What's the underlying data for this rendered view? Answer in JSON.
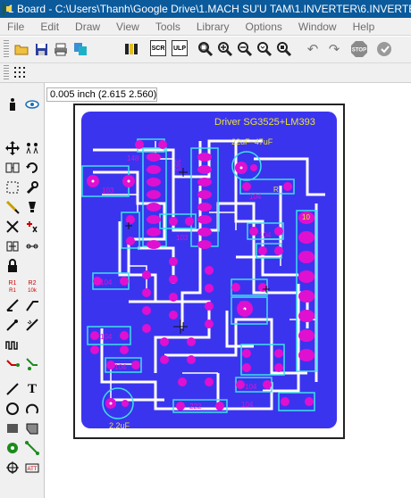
{
  "window": {
    "title": "1 Board - C:\\Users\\Thanh\\Google Drive\\1.MACH SU'U TAM\\1.INVERTER\\6.INVERTER"
  },
  "menu": [
    "File",
    "Edit",
    "Draw",
    "View",
    "Tools",
    "Library",
    "Options",
    "Window",
    "Help"
  ],
  "toolbar": {
    "icons": [
      "open-icon",
      "save-icon",
      "print-icon",
      "copy-icon",
      "library-icon",
      "schematic-icon",
      "ulp-icon",
      "zoom-fit-icon",
      "zoom-in-icon",
      "zoom-out-icon",
      "zoom-redraw-icon",
      "zoom-area-icon",
      "undo-icon",
      "redo-icon",
      "stop-icon",
      "go-icon"
    ],
    "scr_label": "SCR",
    "ulp_label": "ULP",
    "stop_label": "STOP"
  },
  "status": {
    "coordinates": "0.005 inch (2.615 2.560)"
  },
  "board": {
    "title_text": "Driver SG3525+LM393",
    "labels": [
      "22uF~47uF",
      "148",
      "103",
      "393",
      "104",
      "104",
      "103",
      "104",
      "104",
      "104",
      "104",
      "104",
      "104",
      "222",
      "2.2uF",
      "10",
      "R",
      "D"
    ],
    "colors": {
      "copper": "#3b34ef",
      "trace_gap": "#ffffff",
      "pad": "#e010d0",
      "silkscreen": "#3fe0e8",
      "text": "#e8e230"
    }
  },
  "left_tools": [
    "info-icon",
    "eye-icon",
    "move-icon",
    "mirror-icon",
    "group-icon",
    "change-icon",
    "select-icon",
    "wrench-icon",
    "paint-icon",
    "cut-icon",
    "delete-icon",
    "add-icon",
    "replace-icon",
    "lock-icon",
    "value-icon",
    "name-icon",
    "smash-icon",
    "miter-icon",
    "split-icon",
    "optimize-icon",
    "route-icon",
    "ripup-icon",
    "wire-icon",
    "text-icon",
    "circle-icon",
    "arc-icon",
    "rect-icon",
    "polygon-icon",
    "via-icon",
    "signal-icon",
    "hole-icon",
    "attribute-icon"
  ]
}
